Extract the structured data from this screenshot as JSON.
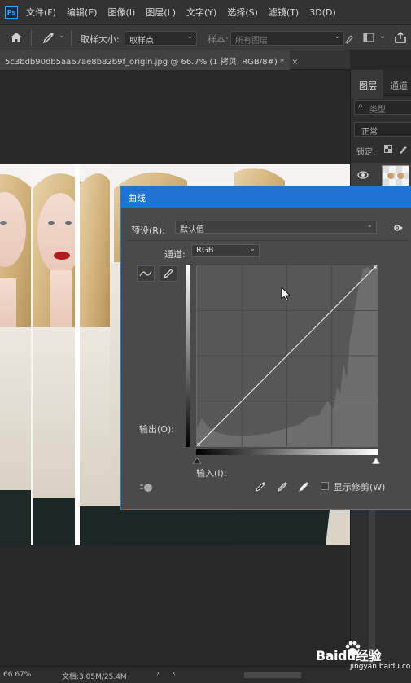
{
  "menubar": {
    "logo": "Ps",
    "items": [
      "文件(F)",
      "编辑(E)",
      "图像(I)",
      "图层(L)",
      "文字(Y)",
      "选择(S)",
      "滤镜(T)",
      "3D(D)"
    ]
  },
  "options": {
    "sample_size_label": "取样大小:",
    "sample_size_value": "取样点",
    "sample_label": "样本:",
    "sample_value": "所有图层"
  },
  "document_tab": {
    "title": "5c3bdb90db5aa67ae8b82b9f_origin.jpg @ 66.7% (1 拷贝, RGB/8#) *",
    "close": "×"
  },
  "layers_panel": {
    "tab_layers": "图层",
    "tab_channels": "通道",
    "search_placeholder": "类型",
    "blend_mode": "正常",
    "lock_label": "锁定:"
  },
  "curves": {
    "title": "曲线",
    "preset_label": "预设(R):",
    "preset_value": "默认值",
    "channel_label": "通道:",
    "channel_value": "RGB",
    "output_label": "输出(O):",
    "input_label": "输入(I):",
    "show_clipping_label": "显示修剪(W)"
  },
  "status": {
    "zoom": "66.67%",
    "doc_info": "文档:3.05M/25.4M"
  },
  "watermark": {
    "brand": "Baidu经验",
    "url": "jingyan.baidu.com"
  },
  "colors": {
    "accent_blue": "#1e74d0",
    "lips_red": "#b01b22"
  }
}
